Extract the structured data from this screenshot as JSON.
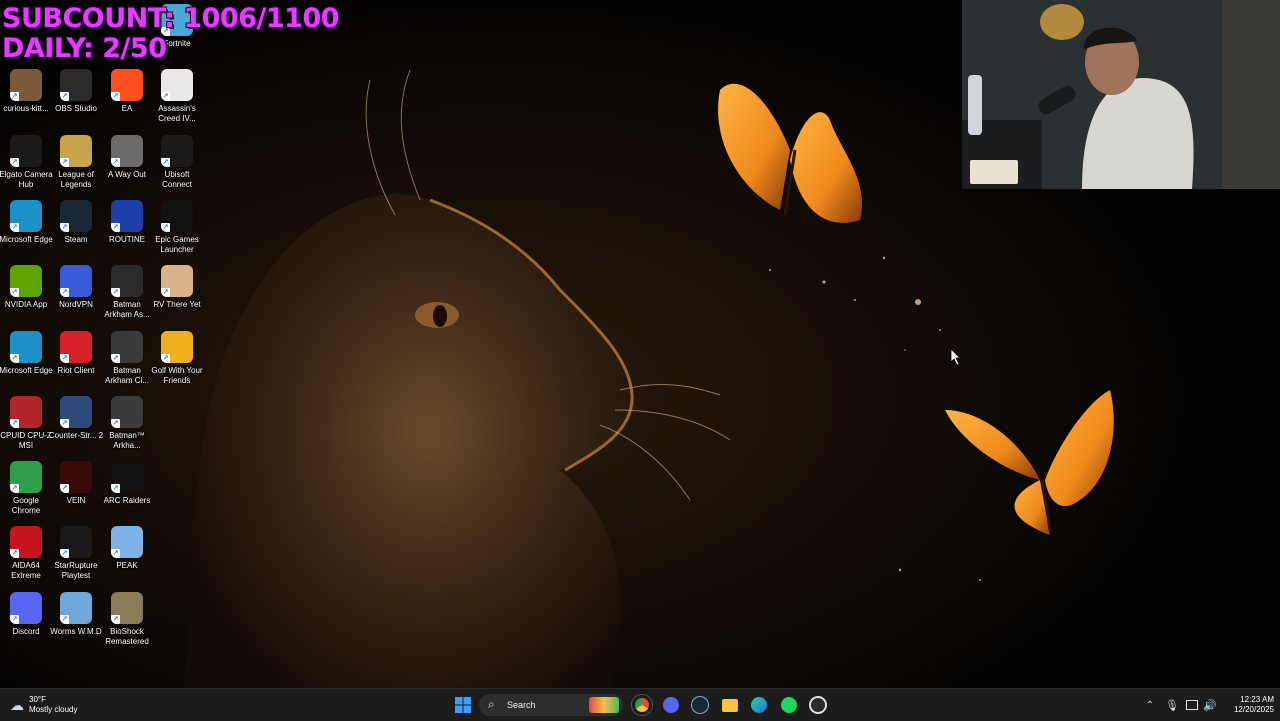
{
  "overlay": {
    "subcount": "SUBCOUNT: 1006/1100",
    "daily": "DAILY: 2/50"
  },
  "desktop": {
    "icons": [
      {
        "label": "Fortnite",
        "icon": "fortnite-icon",
        "color": "#4aa8d8"
      },
      {
        "label": "curious-kitt...",
        "icon": "image-file-icon",
        "color": "#7a5a3a"
      },
      {
        "label": "OBS Studio",
        "icon": "obs-icon",
        "color": "#2b2b2b"
      },
      {
        "label": "EA",
        "icon": "ea-icon",
        "color": "#ff4f1f"
      },
      {
        "label": "Assassin's Creed IV...",
        "icon": "assassins-creed-icon",
        "color": "#e8e8e8"
      },
      {
        "label": "Elgato Camera Hub",
        "icon": "elgato-icon",
        "color": "#1a1a1a"
      },
      {
        "label": "League of Legends",
        "icon": "league-of-legends-icon",
        "color": "#c8a44a"
      },
      {
        "label": "A Way Out",
        "icon": "a-way-out-icon",
        "color": "#6b6b6b"
      },
      {
        "label": "Ubisoft Connect",
        "icon": "ubisoft-icon",
        "color": "#1a1a1a"
      },
      {
        "label": "Microsoft Edge",
        "icon": "edge-icon",
        "color": "#1e90c8"
      },
      {
        "label": "Steam",
        "icon": "steam-icon",
        "color": "#1b2838"
      },
      {
        "label": "ROUTINE",
        "icon": "routine-icon",
        "color": "#1d3fa8"
      },
      {
        "label": "Epic Games Launcher",
        "icon": "epic-games-icon",
        "color": "#111111"
      },
      {
        "label": "NVIDIA App",
        "icon": "nvidia-icon",
        "color": "#5fa400"
      },
      {
        "label": "NordVPN",
        "icon": "nordvpn-icon",
        "color": "#3a5bdc"
      },
      {
        "label": "Batman Arkham As...",
        "icon": "batman-asylum-icon",
        "color": "#2a2a2a"
      },
      {
        "label": "RV There Yet",
        "icon": "rv-there-yet-icon",
        "color": "#d9b48a"
      },
      {
        "label": "Microsoft Edge",
        "icon": "edge-icon",
        "color": "#1e90c8"
      },
      {
        "label": "Riot Client",
        "icon": "riot-client-icon",
        "color": "#d81f2a"
      },
      {
        "label": "Batman Arkham Ci...",
        "icon": "batman-city-icon",
        "color": "#3a3a3a"
      },
      {
        "label": "Golf With Your Friends",
        "icon": "golf-icon",
        "color": "#f0b020"
      },
      {
        "label": "CPUID CPU-Z MSI",
        "icon": "cpuz-icon",
        "color": "#b0262a"
      },
      {
        "label": "Counter-Str... 2",
        "icon": "counter-strike-icon",
        "color": "#2e4a7a"
      },
      {
        "label": "Batman™ Arkha...",
        "icon": "batman-knight-icon",
        "color": "#3a3a3a"
      },
      {
        "label": "Google Chrome",
        "icon": "chrome-icon",
        "color": "#2f9e4a"
      },
      {
        "label": "VEIN",
        "icon": "vein-icon",
        "color": "#3a0a0a"
      },
      {
        "label": "ARC Raiders",
        "icon": "arc-raiders-icon",
        "color": "#111111"
      },
      {
        "label": "AIDA64 Extreme",
        "icon": "aida64-icon",
        "color": "#c4161c"
      },
      {
        "label": "StarRupture Playtest",
        "icon": "starrupture-icon",
        "color": "#1a1a1a"
      },
      {
        "label": "PEAK",
        "icon": "peak-icon",
        "color": "#7fb2e8"
      },
      {
        "label": "Discord",
        "icon": "discord-icon",
        "color": "#5865f2"
      },
      {
        "label": "Worms W.M.D",
        "icon": "worms-icon",
        "color": "#6fa8d8"
      },
      {
        "label": "BioShock Remastered",
        "icon": "bioshock-icon",
        "color": "#8a7a5a"
      }
    ]
  },
  "taskbar": {
    "weather": {
      "temp": "30°F",
      "condition": "Mostly cloudy"
    },
    "search_placeholder": "Search",
    "clock": {
      "time": "12:23 AM",
      "date": "12/20/2025"
    },
    "apps": [
      "widgets-icon",
      "chrome-icon",
      "discord-icon",
      "steam-icon",
      "file-explorer-icon",
      "edge-icon",
      "spotify-icon",
      "obs-icon"
    ]
  }
}
